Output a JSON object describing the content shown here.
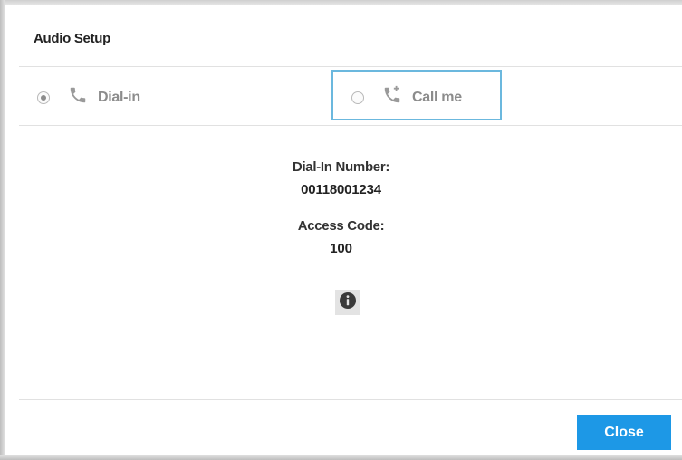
{
  "dialog": {
    "title": "Audio Setup"
  },
  "options": [
    {
      "label": "Dial-in",
      "selected": true,
      "icon": "phone-icon"
    },
    {
      "label": "Call me",
      "selected": false,
      "icon": "phone-callback-icon"
    }
  ],
  "details": {
    "dial_in_number_label": "Dial-In Number:",
    "dial_in_number_value": "00118001234",
    "access_code_label": "Access Code:",
    "access_code_value": "100",
    "info_icon": "info-icon"
  },
  "footer": {
    "close_label": "Close"
  },
  "colors": {
    "accent": "#1d98e6",
    "focus_outline": "#6bb8de",
    "option_text": "#8c8c8c"
  }
}
